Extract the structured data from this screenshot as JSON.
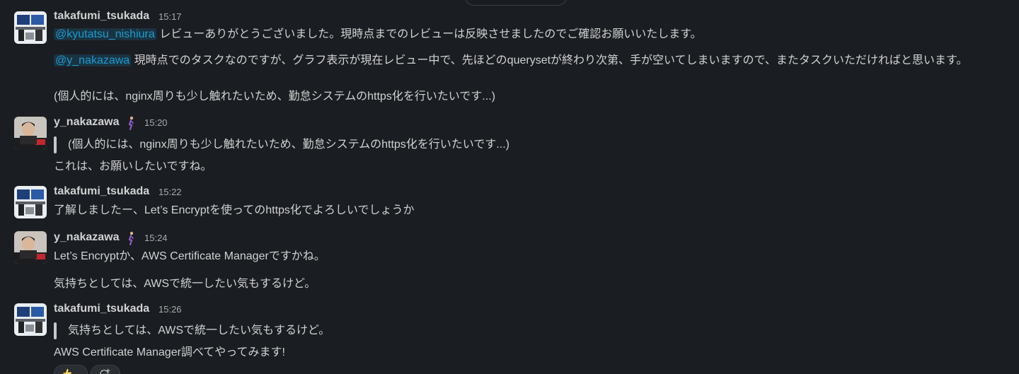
{
  "messages": [
    {
      "user": "takafumi_tsukada",
      "time": "15:17",
      "line1": {
        "mention": "@kyutatsu_nishiura",
        "text": " レビューありがとうございました。現時点までのレビューは反映させましたのでご確認お願いいたします。"
      },
      "line2": {
        "mention": "@y_nakazawa",
        "text": " 現時点でのタスクなのですが、グラフ表示が現在レビュー中で、先ほどのquerysetが終わり次第、手が空いてしまいますので、またタスクいただければと思います。"
      },
      "line3": "(個人的には、nginx周りも少し触れたいため、勤怠システムのhttps化を行いたいです...)"
    },
    {
      "user": "y_nakazawa",
      "time": "15:20",
      "quote": "(個人的には、nginx周りも少し触れたいため、勤怠システムのhttps化を行いたいです...)",
      "text": "これは、お願いしたいですね。"
    },
    {
      "user": "takafumi_tsukada",
      "time": "15:22",
      "text": "了解しましたー、Let’s Encryptを使ってのhttps化でよろしいでしょうか"
    },
    {
      "user": "y_nakazawa",
      "time": "15:24",
      "text1": "Let’s Encryptか、AWS Certificate Managerですかね。",
      "text2": "気持ちとしては、AWSで統一したい気もするけど。"
    },
    {
      "user": "takafumi_tsukada",
      "time": "15:26",
      "quote": "気持ちとしては、AWSで統一したい気もするけど。",
      "text": "AWS Certificate Manager調べてやってみます!"
    }
  ],
  "icons": {
    "status": "runner-emoji-icon",
    "reaction_emoji": "thumbs-up-icon",
    "add_reaction": "add-reaction-icon"
  },
  "colors": {
    "background": "#1a1d21",
    "text": "#d1d2d3",
    "timestamp": "#ababad",
    "mention": "#1d9bd1",
    "quote_bar": "#c7c8c9"
  }
}
